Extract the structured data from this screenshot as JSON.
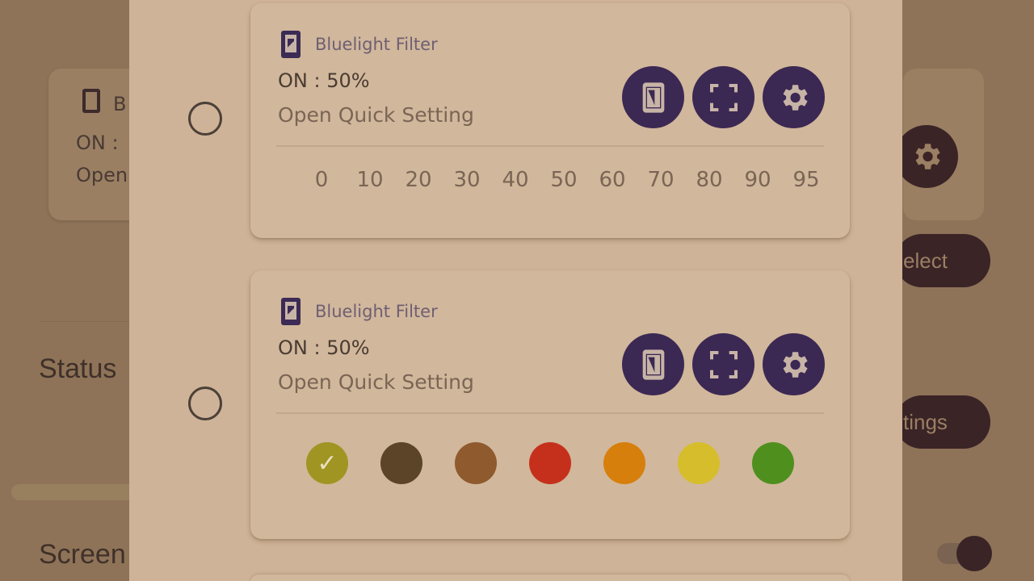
{
  "background": {
    "card_app_label": "B",
    "card_status": "ON :",
    "card_open": "Open",
    "status_label": "Status",
    "screen_label": "Screen",
    "select_pill": "elect",
    "settings_pill": "tings"
  },
  "options": [
    {
      "app_name": "Bluelight Filter",
      "status": "ON : 50%",
      "open_label": "Open Quick Setting",
      "opacity_levels": [
        "0",
        "10",
        "20",
        "30",
        "40",
        "50",
        "60",
        "70",
        "80",
        "90",
        "95"
      ]
    },
    {
      "app_name": "Bluelight Filter",
      "status": "ON : 50%",
      "open_label": "Open Quick Setting",
      "color_swatches": [
        {
          "name": "olive",
          "color": "#a09523",
          "selected": true
        },
        {
          "name": "dark-brown",
          "color": "#5b4427"
        },
        {
          "name": "brown",
          "color": "#8e5a2e"
        },
        {
          "name": "red",
          "color": "#c5301c"
        },
        {
          "name": "orange",
          "color": "#d67f0c"
        },
        {
          "name": "yellow",
          "color": "#d6bd2c"
        },
        {
          "name": "green",
          "color": "#4f8f1e"
        }
      ],
      "check_glyph": "✓"
    }
  ],
  "icons": {
    "phone": "phone-filter-icon",
    "fullscreen": "fullscreen-icon",
    "settings": "gear-icon"
  },
  "colors": {
    "accent": "#3b2853",
    "dialog_bg": "#ceb398",
    "card_bg": "#d1b79b"
  }
}
